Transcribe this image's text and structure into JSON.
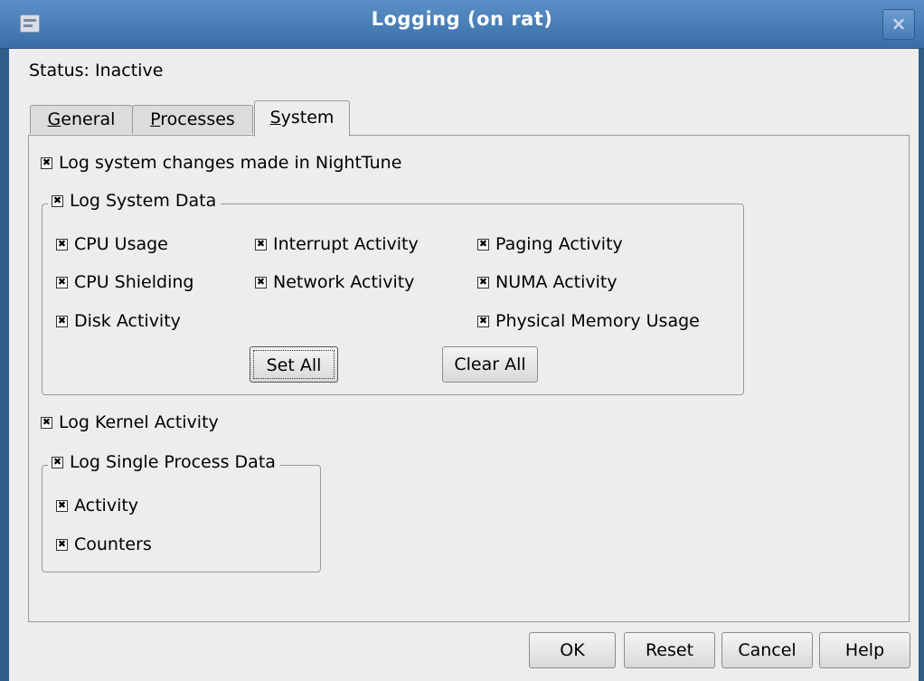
{
  "window": {
    "title": "Logging (on rat)",
    "close_glyph": "×"
  },
  "status": "Status: Inactive",
  "tabs": [
    {
      "label": "General",
      "mnemonic": "G",
      "rest": "eneral",
      "active": false
    },
    {
      "label": "Processes",
      "mnemonic": "P",
      "rest": "rocesses",
      "active": false
    },
    {
      "label": "System",
      "mnemonic": "S",
      "rest": "ystem",
      "active": true
    }
  ],
  "system": {
    "log_changes": {
      "label": "Log system changes made in NightTune",
      "checked": true
    },
    "system_data": {
      "label": "Log System Data",
      "checked": true,
      "items": [
        {
          "label": "CPU Usage",
          "checked": true
        },
        {
          "label": "Interrupt Activity",
          "checked": true
        },
        {
          "label": "Paging Activity",
          "checked": true
        },
        {
          "label": "CPU Shielding",
          "checked": true
        },
        {
          "label": "Network Activity",
          "checked": true
        },
        {
          "label": "NUMA Activity",
          "checked": true
        },
        {
          "label": "Disk Activity",
          "checked": true
        },
        {
          "label": "Physical Memory Usage",
          "checked": true
        }
      ],
      "set_all": "Set All",
      "clear_all": "Clear All"
    },
    "kernel_activity": {
      "label": "Log Kernel Activity",
      "checked": true
    },
    "single_process": {
      "label": "Log Single Process Data",
      "checked": true,
      "items": [
        {
          "label": "Activity",
          "checked": true
        },
        {
          "label": "Counters",
          "checked": true
        }
      ]
    }
  },
  "buttons": {
    "ok": "OK",
    "reset": "Reset",
    "cancel": "Cancel",
    "help": "Help"
  }
}
